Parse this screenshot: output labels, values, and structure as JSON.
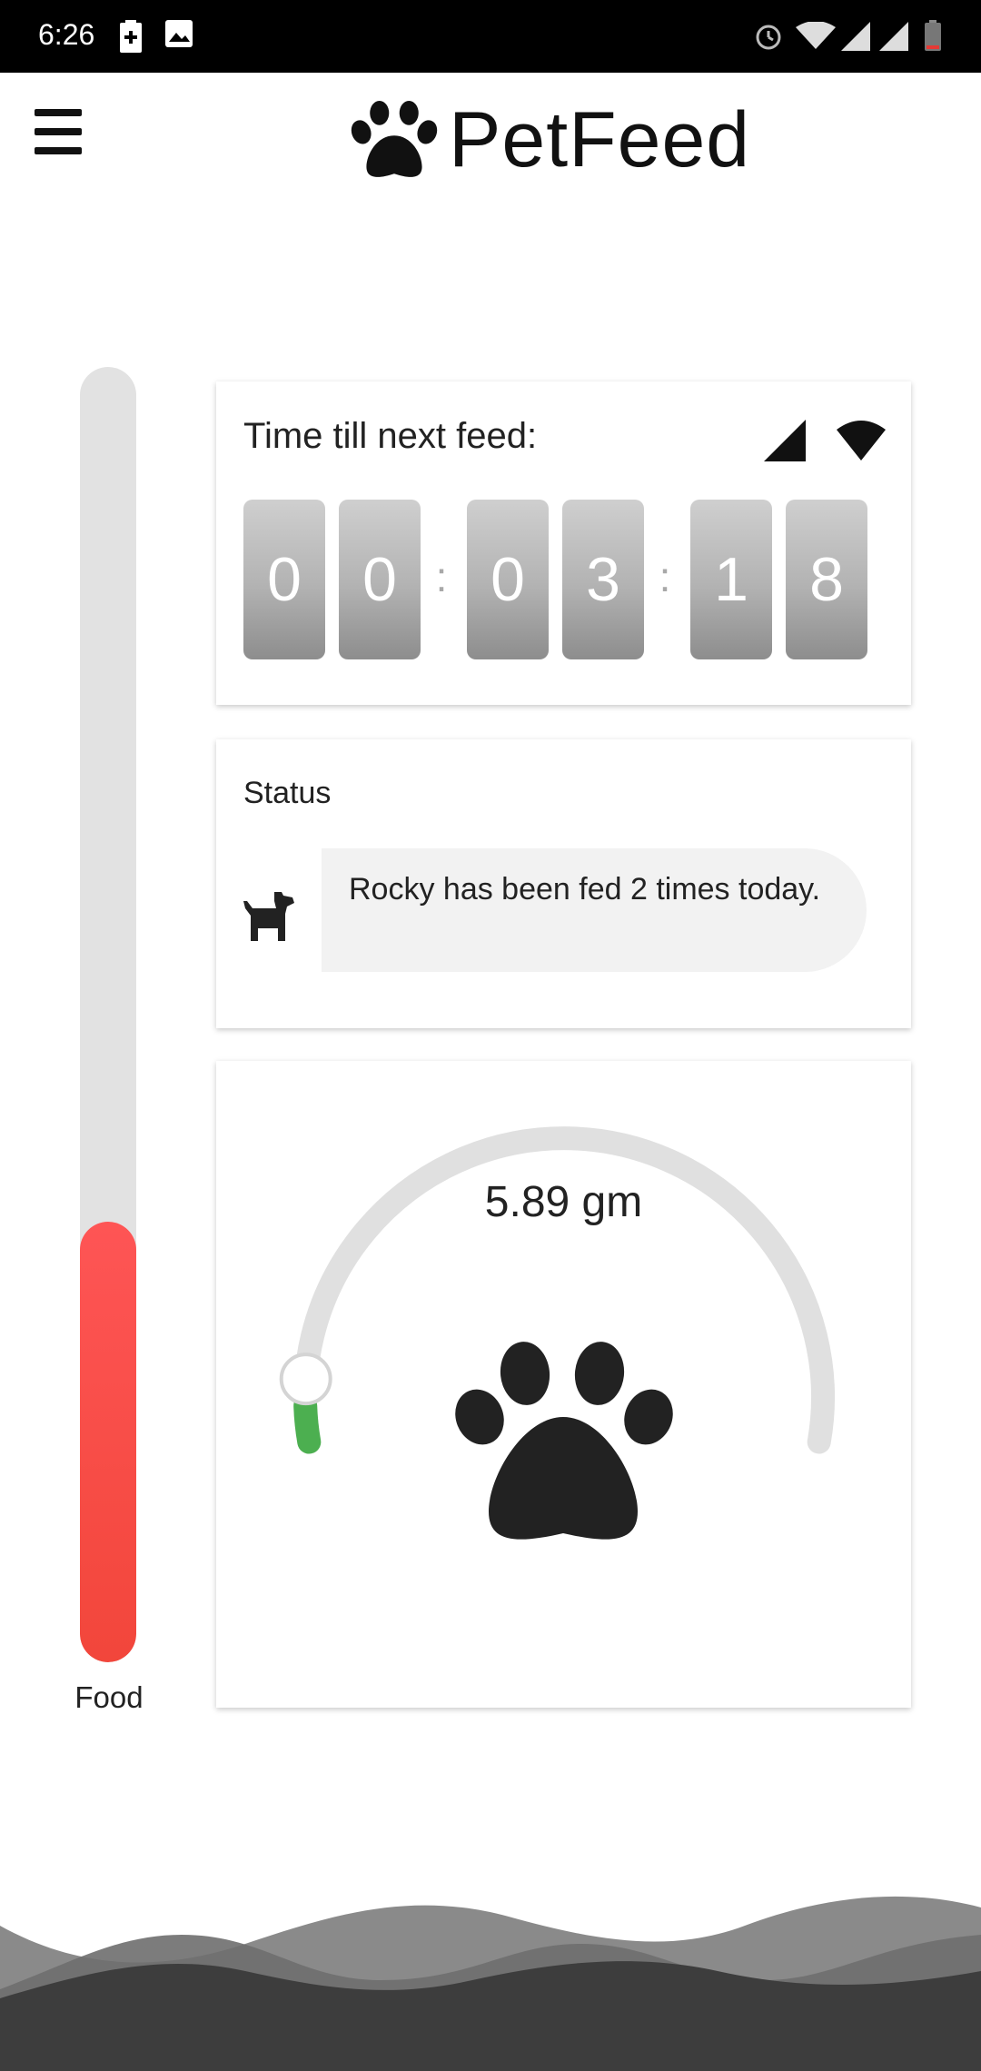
{
  "status_bar": {
    "time": "6:26",
    "icons": [
      "battery-saver-icon",
      "image-icon",
      "alarm-icon",
      "wifi-icon",
      "signal-icon",
      "signal-icon",
      "battery-low-icon"
    ]
  },
  "header": {
    "title": "PetFeed",
    "menu_icon": "hamburger-menu-icon",
    "logo_icon": "paw-icon"
  },
  "food_level": {
    "label": "Food",
    "fill_fraction": 0.34,
    "color": "#f44336"
  },
  "timer": {
    "label": "Time till next feed:",
    "digits": [
      "0",
      "0",
      "0",
      "3",
      "1",
      "8"
    ],
    "separators": [
      ":",
      ":"
    ],
    "icons": [
      "signal-icon",
      "wifi-icon"
    ]
  },
  "status": {
    "title": "Status",
    "message": "Rocky has been fed 2 times today.",
    "icon": "dog-icon"
  },
  "gauge": {
    "value_text": "5.89 gm",
    "fraction": 0.04,
    "track_color": "#e0e0e0",
    "fill_color": "#4caf50",
    "icon": "paw-icon"
  },
  "colors": {
    "accent_red": "#f44336",
    "accent_green": "#4caf50",
    "wave_dark": "#3d3d3d",
    "wave_light": "#8a8a8a"
  }
}
